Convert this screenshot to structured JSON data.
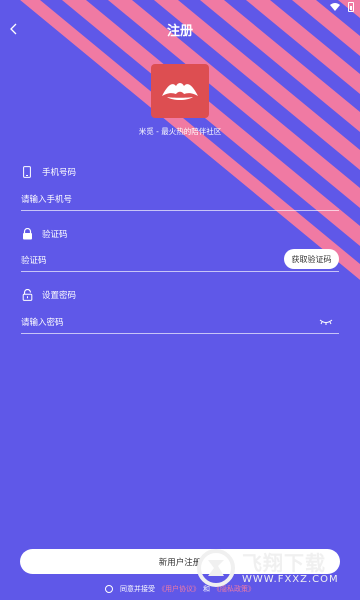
{
  "header": {
    "title": "注册"
  },
  "app": {
    "tagline": "米觅 - 最火热的陪伴社区"
  },
  "phone": {
    "label": "手机号码",
    "placeholder": "请输入手机号"
  },
  "code": {
    "label": "验证码",
    "placeholder": "验证码",
    "button_label": "获取验证码"
  },
  "password": {
    "label": "设置密码",
    "placeholder": "请输入密码"
  },
  "register_button": {
    "label": "新用户注册"
  },
  "agreement": {
    "prefix": "同意并接受",
    "user_agreement": "《用户协议》",
    "connector": "和",
    "privacy_policy": "《隐私政策》"
  },
  "watermark": {
    "brand": "飞翔下载",
    "url": "WWW.FXXZ.COM"
  },
  "colors": {
    "background": "#5f58e8",
    "stripe": "#f07aa3",
    "logo": "#dd4e51",
    "link": "#f07aa3"
  },
  "icons": [
    "back-arrow-icon",
    "wifi-icon",
    "battery-icon",
    "phone-icon",
    "lock-icon",
    "unlock-icon",
    "eye-closed-icon",
    "radio-icon"
  ]
}
